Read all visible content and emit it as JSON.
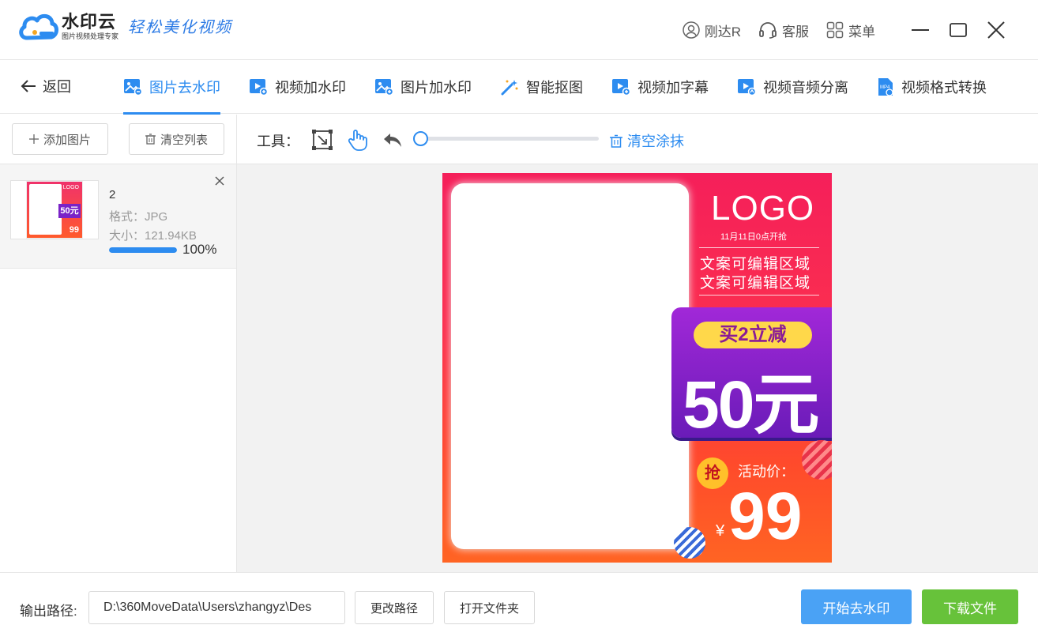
{
  "app": {
    "brand_name": "水印云",
    "brand_sub": "图片视频处理专家",
    "slogan": "轻松美化视频",
    "user_name": "刚达R",
    "service_label": "客服",
    "menu_label": "菜单"
  },
  "nav": {
    "back_label": "返回",
    "tabs": [
      {
        "label": "图片去水印",
        "icon": "image-remove-watermark-icon",
        "active": true
      },
      {
        "label": "视频加水印",
        "icon": "video-add-watermark-icon"
      },
      {
        "label": "图片加水印",
        "icon": "image-add-watermark-icon"
      },
      {
        "label": "智能抠图",
        "icon": "magic-wand-icon"
      },
      {
        "label": "视频加字幕",
        "icon": "video-subtitle-icon"
      },
      {
        "label": "视频音频分离",
        "icon": "video-audio-split-icon"
      },
      {
        "label": "视频格式转换",
        "icon": "mp4-icon"
      }
    ]
  },
  "left_panel": {
    "add_image_label": "添加图片",
    "clear_list_label": "清空列表",
    "files": [
      {
        "name": "2",
        "format": "格式：JPG",
        "size": "大小：121.94KB",
        "progress": 100,
        "progress_text": "100%"
      }
    ]
  },
  "edit_toolbar": {
    "tools_label": "工具：",
    "brush_size": 0,
    "clear_smear_label": "清空涂抹"
  },
  "poster": {
    "logo": "LOGO",
    "date": "11月11日0点开抢",
    "copy_line1": "文案可编辑区域",
    "copy_line2": "文案可编辑区域",
    "buy_label": "买2立减",
    "discount": "50元",
    "grab": "抢",
    "price_label": "活动价：",
    "currency": "¥",
    "price": "99"
  },
  "bottom": {
    "output_label": "输出路径:",
    "output_path": "D:\\360MoveData\\Users\\zhangyz\\Des",
    "change_path_label": "更改路径",
    "open_folder_label": "打开文件夹",
    "start_label": "开始去水印",
    "download_label": "下载文件"
  },
  "colors": {
    "accent": "#2d8cf0",
    "start_button": "#4aa2f5",
    "download_button": "#67c23a"
  }
}
